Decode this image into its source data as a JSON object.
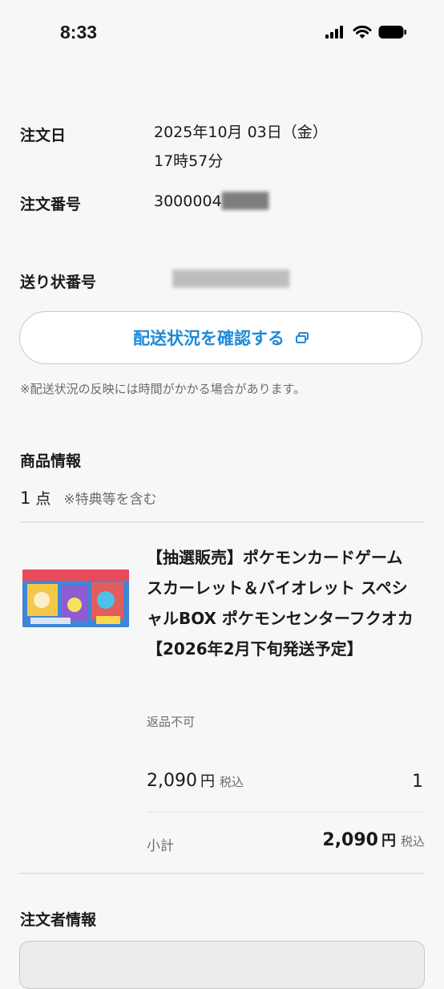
{
  "status_bar": {
    "time": "8:33"
  },
  "order": {
    "date_label": "注文日",
    "date_line1": "2025年10月 03日（金）",
    "date_line2": "17時57分",
    "number_label": "注文番号",
    "number_value": "3000004"
  },
  "shipping": {
    "tracking_label": "送り状番号",
    "track_button_label": "配送状況を確認する",
    "note": "※配送状況の反映には時間がかかる場合があります。"
  },
  "product_info": {
    "section_title": "商品情報",
    "count": "1",
    "count_unit": "点",
    "count_note": "※特典等を含む",
    "item": {
      "name": "【抽選販売】ポケモンカードゲーム スカーレット＆バイオレット スペシャルBOX ポケモンセンターフクオカ【2026年2月下旬発送予定】",
      "return_note": "返品不可",
      "price": "2,090",
      "yen": "円",
      "tax_label": "税込",
      "quantity": "1"
    },
    "subtotal_label": "小計",
    "subtotal_value": "2,090",
    "subtotal_yen": "円",
    "subtotal_tax": "税込"
  },
  "orderer": {
    "section_title": "注文者情報"
  },
  "colors": {
    "accent": "#1f8ad6",
    "background": "#f7f7f7"
  },
  "icons": [
    "signal-icon",
    "wifi-icon",
    "battery-icon",
    "external-link-icon"
  ]
}
